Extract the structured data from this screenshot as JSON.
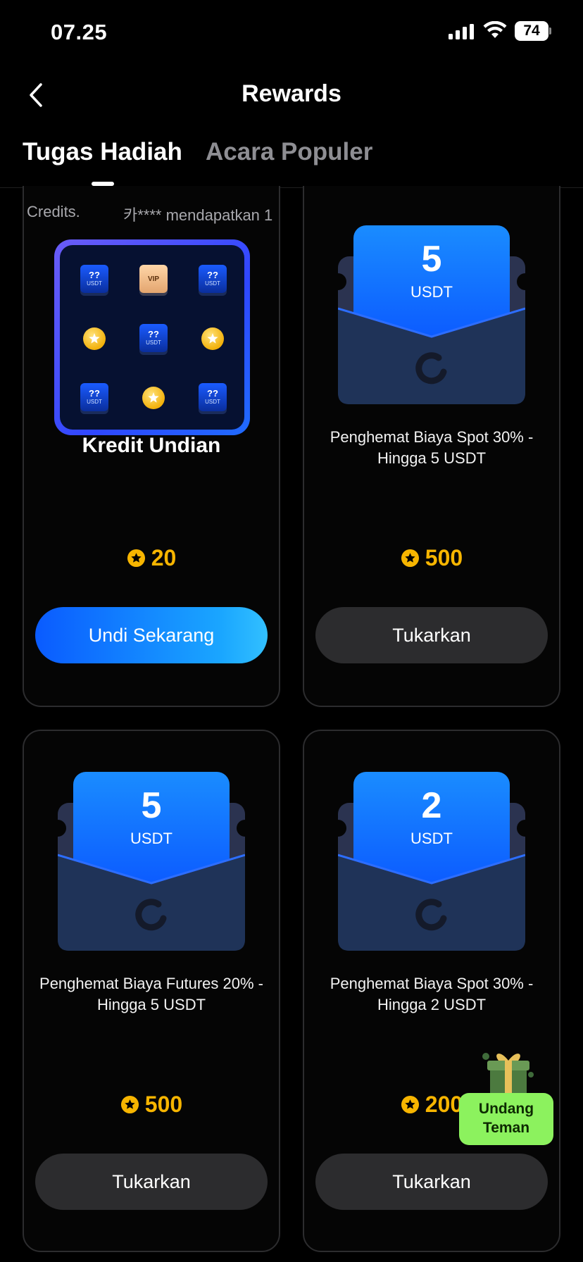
{
  "status_bar": {
    "time": "07.25",
    "battery": "74"
  },
  "nav": {
    "title": "Rewards"
  },
  "tabs": [
    {
      "label": "Tugas Hadiah",
      "active": true
    },
    {
      "label": "Acara Populer",
      "active": false
    }
  ],
  "cards": [
    {
      "ticker": [
        "Credits.",
        "카**** mendapatkan 1"
      ],
      "title": "Kredit Undian",
      "price": "20",
      "button": "Undi Sekarang",
      "lottery_items": [
        "usdt",
        "vip",
        "usdt",
        "coin",
        "usdt",
        "coin",
        "usdt",
        "coin",
        "usdt"
      ],
      "lottery_labels": {
        "question": "??",
        "usdt": "USDT",
        "vip": "VIP"
      }
    },
    {
      "amount": "5",
      "unit": "USDT",
      "description": "Penghemat Biaya Spot 30% - Hingga 5 USDT",
      "price": "500",
      "button": "Tukarkan"
    },
    {
      "amount": "5",
      "unit": "USDT",
      "description": "Penghemat Biaya Futures 20% - Hingga 5 USDT",
      "price": "500",
      "button": "Tukarkan"
    },
    {
      "amount": "2",
      "unit": "USDT",
      "description": "Penghemat Biaya Spot 30% - Hingga 2 USDT",
      "price": "200",
      "button": "Tukarkan"
    }
  ],
  "invite": {
    "label": "Undang Teman"
  },
  "colors": {
    "accent": "#0a5bff",
    "points": "#f7b500",
    "invite": "#8cf25e"
  }
}
